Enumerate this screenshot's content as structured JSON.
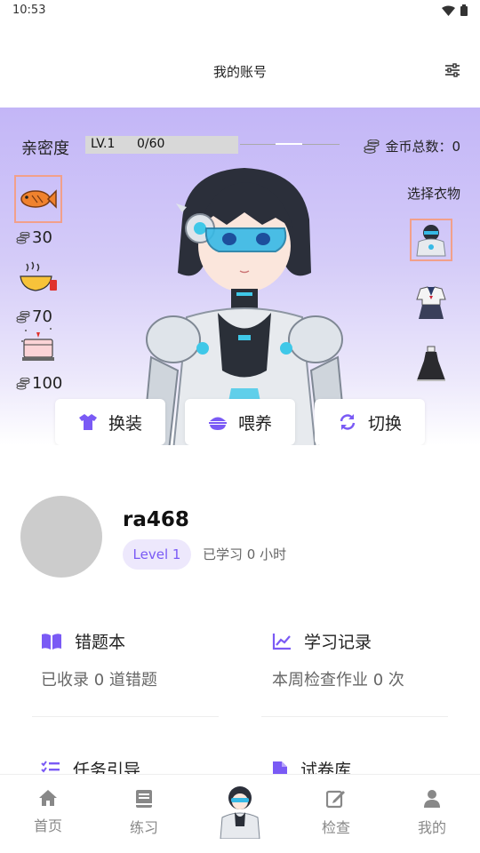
{
  "status_bar": {
    "time": "10:53",
    "icons": [
      "wifi-icon",
      "battery-icon"
    ]
  },
  "header": {
    "title": "我的账号",
    "settings_icon": "sliders-icon"
  },
  "pet": {
    "intimacy_label": "亲密度",
    "level": "LV.1",
    "progress_text": "0/60",
    "progress_fraction": 0,
    "coins_label": "金币总数：0",
    "foods": [
      {
        "name": "fish",
        "price": "30",
        "selected": true
      },
      {
        "name": "noodles",
        "price": "70",
        "selected": false
      },
      {
        "name": "cake",
        "price": "100",
        "selected": false
      }
    ],
    "choose_clothes_label": "选择衣物",
    "clothes": [
      {
        "name": "mecha-suit",
        "selected": true
      },
      {
        "name": "sailor-uniform",
        "selected": false
      },
      {
        "name": "black-dress",
        "selected": false
      }
    ],
    "actions": [
      {
        "label": "换装",
        "icon": "shirt-icon"
      },
      {
        "label": "喂养",
        "icon": "food-bowl-icon"
      },
      {
        "label": "切换",
        "icon": "refresh-icon"
      }
    ]
  },
  "profile": {
    "username": "ra468",
    "level_badge": "Level 1",
    "study_time": "已学习 0 小时"
  },
  "features": [
    {
      "title": "错题本",
      "subtitle": "已收录 0 道错题",
      "icon": "book-icon"
    },
    {
      "title": "学习记录",
      "subtitle": "本周检查作业 0 次",
      "icon": "chart-line-icon"
    },
    {
      "title": "任务引导",
      "subtitle": "",
      "icon": "checklist-icon"
    },
    {
      "title": "试卷库",
      "subtitle": "",
      "icon": "document-icon"
    }
  ],
  "bottom_nav": {
    "items": [
      {
        "label": "首页",
        "icon": "home-icon"
      },
      {
        "label": "练习",
        "icon": "notebook-icon"
      },
      {
        "label": "",
        "icon": "character-avatar"
      },
      {
        "label": "检查",
        "icon": "edit-icon"
      },
      {
        "label": "我的",
        "icon": "person-icon"
      }
    ]
  },
  "colors": {
    "accent": "#7a5af5",
    "hero_top": "#c3b6f7",
    "selected_border": "#f2a08a"
  }
}
